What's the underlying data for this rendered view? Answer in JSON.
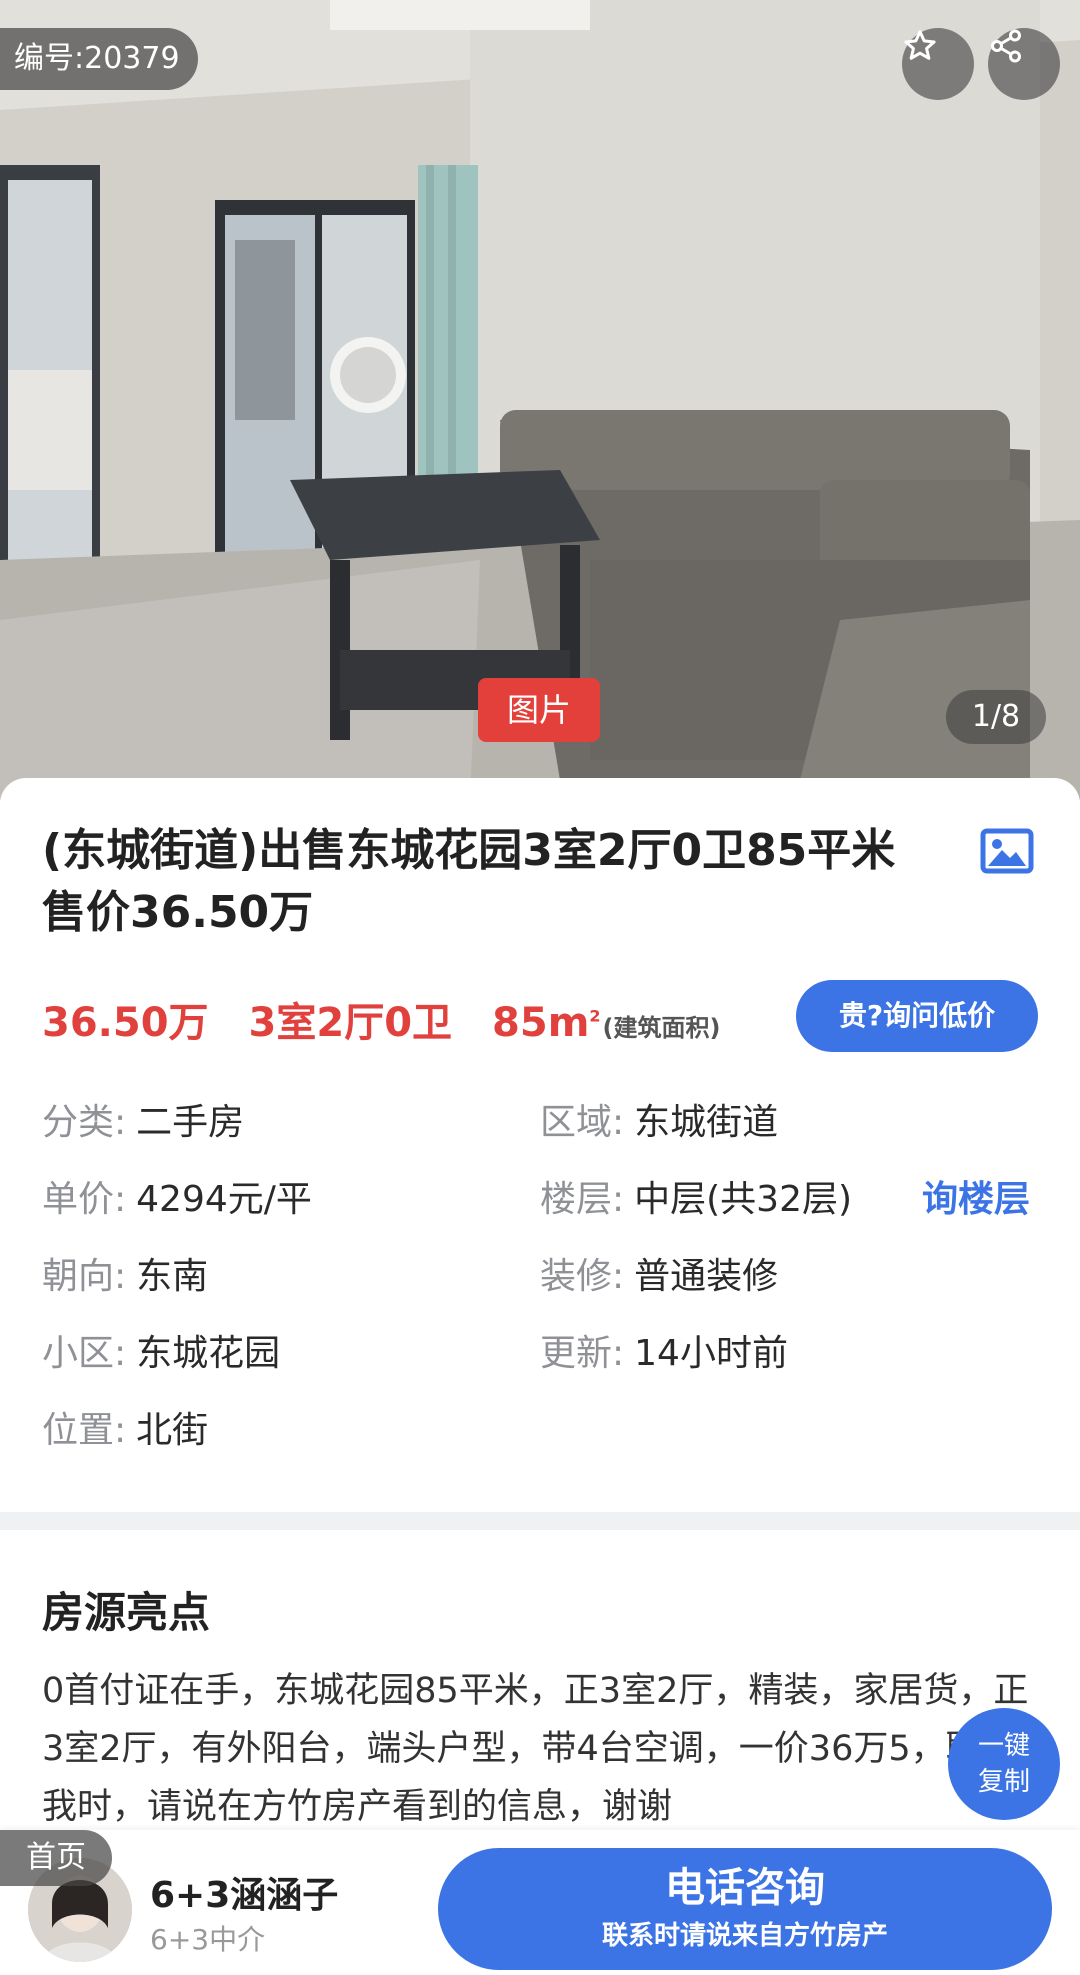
{
  "listing": {
    "id_label": "编号:20379",
    "photo_tag": "图片",
    "photo_counter": "1/8",
    "title": "(东城街道)出售东城花园3室2厅0卫85平米 售价36.50万",
    "price": "36.50万",
    "layout": "3室2厅0卫",
    "area_num": "85m",
    "area_sup": "2",
    "area_note": "(建筑面积)",
    "ask_button": "贵?询问低价",
    "floor_link": "询楼层"
  },
  "details": [
    {
      "key": "分类:",
      "value": "二手房"
    },
    {
      "key": "区域:",
      "value": "东城街道"
    },
    {
      "key": "单价:",
      "value": "4294元/平"
    },
    {
      "key": "楼层:",
      "value": "中层(共32层)"
    },
    {
      "key": "朝向:",
      "value": "东南"
    },
    {
      "key": "装修:",
      "value": "普通装修"
    },
    {
      "key": "小区:",
      "value": "东城花园"
    },
    {
      "key": "更新:",
      "value": "14小时前"
    },
    {
      "key": "位置:",
      "value": "北街"
    }
  ],
  "highlights": {
    "title": "房源亮点",
    "text": "0首付证在手，东城花园85平米，正3室2厅，精装，家居货，正3室2厅，有外阳台，端头户型，带4台空调，一价36万5，联系我时，请说在方竹房产看到的信息，谢谢",
    "copy_line1": "一键",
    "copy_line2": "复制"
  },
  "bottom_bar": {
    "home_label": "首页",
    "agent_name": "6+3涵涵子",
    "agent_role": "6+3中介",
    "call_title": "电话咨询",
    "call_subtitle": "联系时请说来自方竹房产"
  },
  "colors": {
    "accent": "#3c74e6",
    "price_red": "#e0413d",
    "tag_red": "#e4403b"
  },
  "icons": [
    "star-icon",
    "share-icon",
    "gallery-icon"
  ]
}
